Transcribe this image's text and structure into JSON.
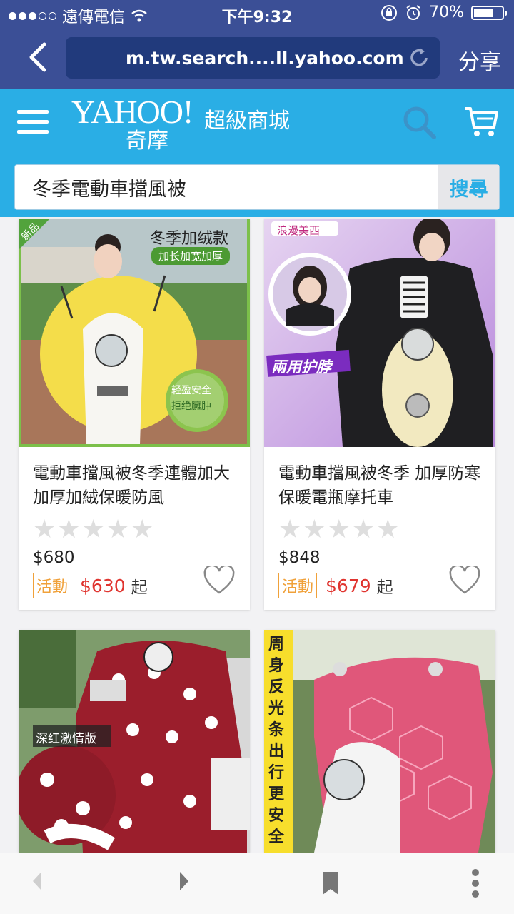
{
  "status": {
    "carrier": "遠傳電信",
    "time": "下午9:32",
    "battery": "70%",
    "battery_level": 0.7
  },
  "browser": {
    "url": "m.tw.search....ll.yahoo.com",
    "share_label": "分享"
  },
  "header": {
    "logo_wordmark": "YAHOO!",
    "logo_sub": "奇摩",
    "store_name": "超級商城"
  },
  "search": {
    "query": "冬季電動車擋風被",
    "button_label": "搜尋"
  },
  "products": [
    {
      "title": "電動車擋風被冬季連體加大加厚加絨保暖防風",
      "rating": 0,
      "price": "$680",
      "promo_label": "活動",
      "sale_price": "$630",
      "sale_suffix": "起",
      "badge": "新品",
      "overlay_title": "冬季加绒款",
      "overlay_sub": "加长加宽加厚",
      "overlay_circle_1": "轻盈安全",
      "overlay_circle_2": "拒绝臃肿"
    },
    {
      "title": "電動車擋風被冬季 加厚防寒保暖電瓶摩托車",
      "rating": 0,
      "price": "$848",
      "promo_label": "活動",
      "sale_price": "$679",
      "sale_suffix": "起",
      "brand_label": "浪漫美西",
      "overlay_title": "兩用护脖"
    },
    {
      "overlay_label": "深红激情版"
    },
    {
      "overlay_vertical": "周身反光条 出行更安全"
    }
  ],
  "colors": {
    "browser_bar": "#3b4f96",
    "yahoo_blue": "#2aaee5",
    "sale_red": "#e0342f",
    "promo_orange": "#f0a13a"
  }
}
